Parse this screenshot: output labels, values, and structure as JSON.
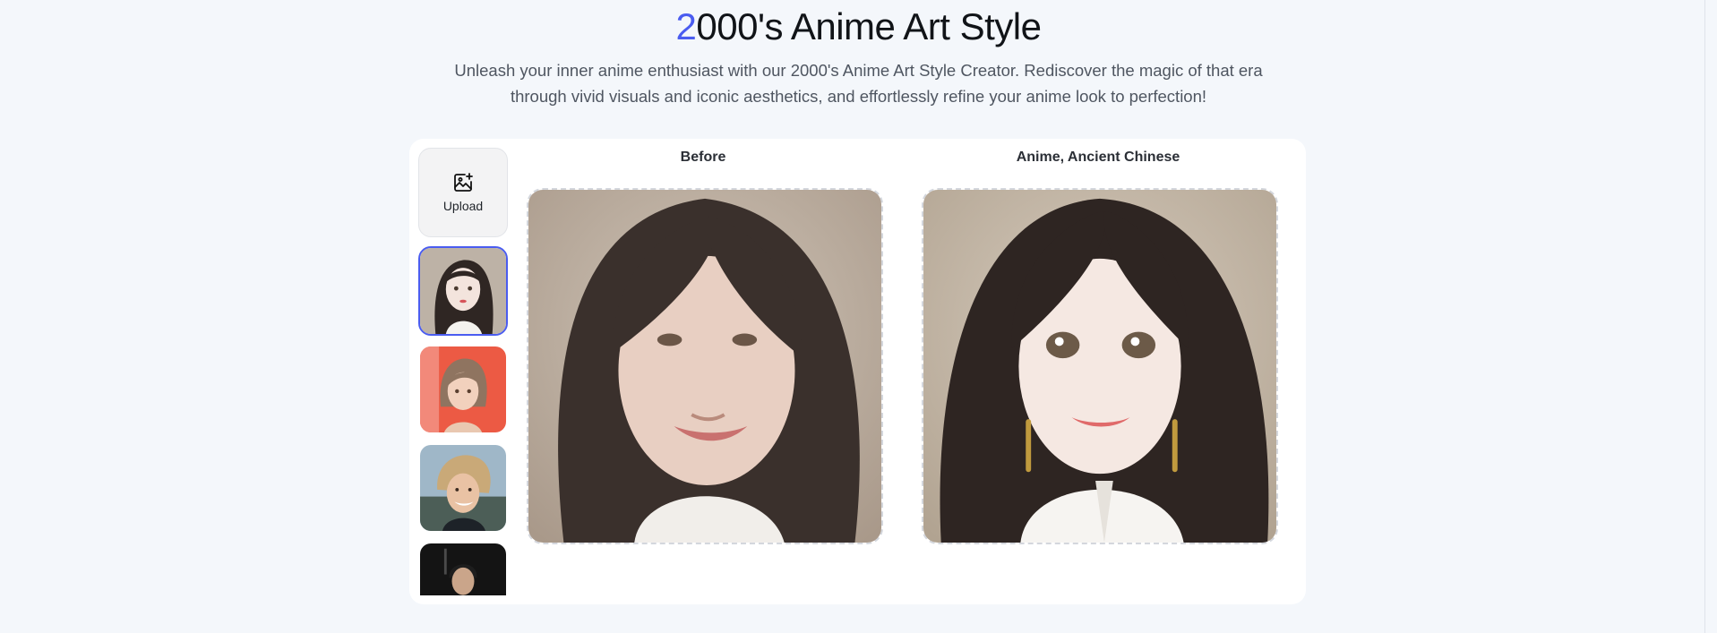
{
  "header": {
    "title_accent": "2",
    "title_rest": "000's Anime Art Style",
    "subtitle": "Unleash your inner anime enthusiast with our 2000's Anime Art Style Creator. Rediscover the magic of that era through vivid visuals and iconic aesthetics, and effortlessly refine your anime look to perfection!"
  },
  "sidebar": {
    "upload_label": "Upload",
    "thumbnails": [
      {
        "id": "thumb-1",
        "selected": true
      },
      {
        "id": "thumb-2",
        "selected": false
      },
      {
        "id": "thumb-3",
        "selected": false
      },
      {
        "id": "thumb-4",
        "selected": false
      }
    ]
  },
  "preview": {
    "before_label": "Before",
    "after_label": "Anime, Ancient Chinese"
  },
  "colors": {
    "accent": "#4a5cf0",
    "background": "#f4f7fb",
    "panel": "#ffffff"
  },
  "icons": {
    "upload": "image-plus-icon"
  }
}
